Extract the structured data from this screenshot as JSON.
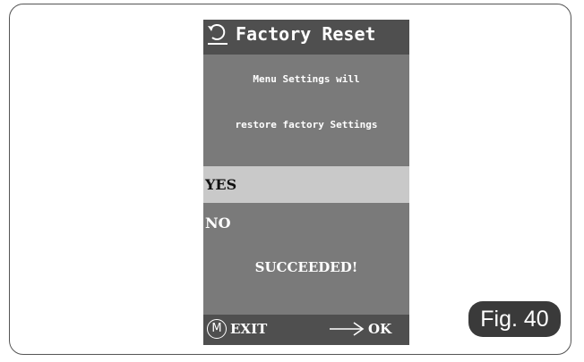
{
  "screen": {
    "title": "Factory Reset",
    "message_line1": "Menu Settings will",
    "message_line2": "restore factory Settings",
    "options": [
      {
        "label": "YES",
        "selected": true
      },
      {
        "label": "NO",
        "selected": false
      }
    ],
    "status": "SUCCEEDED!",
    "footer": {
      "menu_icon_glyph": "M",
      "exit_label": "EXIT",
      "ok_label": "OK"
    }
  },
  "figure_label": "Fig. 40",
  "colors": {
    "screen_bg": "#7a7a7a",
    "bar_bg": "#4f4f4f",
    "selected_bg": "#c9c9c9",
    "badge_bg": "#3a3a3a"
  },
  "icons": [
    "back-icon",
    "menu-icon",
    "arrow-right-icon"
  ]
}
